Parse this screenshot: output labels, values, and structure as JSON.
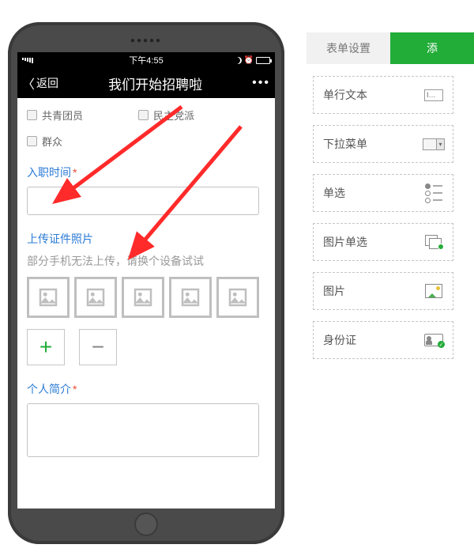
{
  "phone": {
    "status": {
      "time": "下午4:55",
      "battery_pct": ""
    },
    "nav": {
      "back": "返回",
      "title": "我们开始招聘啦",
      "more": "•••"
    },
    "checks": {
      "row1": {
        "a": "共青团员",
        "b": "民主党派"
      },
      "row2": {
        "a": "群众"
      }
    },
    "sections": {
      "date_label": "入职时间",
      "upload_label": "上传证件照片",
      "upload_helper": "部分手机无法上传，请换个设备试试",
      "bio_label": "个人简介"
    }
  },
  "tabs": {
    "settings": "表单设置",
    "add": "添"
  },
  "widgets": {
    "text": "单行文本",
    "text_icon": "I…",
    "dropdown": "下拉菜单",
    "radio": "单选",
    "imgradio": "图片单选",
    "image": "图片",
    "idcard": "身份证"
  }
}
